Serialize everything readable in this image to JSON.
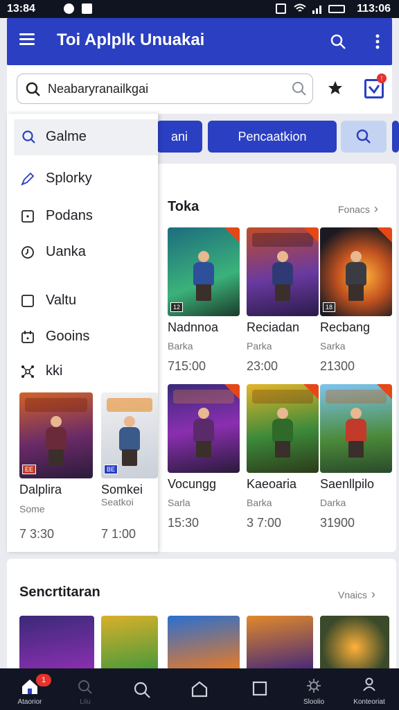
{
  "status_bar": {
    "time": "13:84",
    "right_time": "113:06"
  },
  "app_bar": {
    "title": "Toi Aplplk Unuakai"
  },
  "search": {
    "query": "Neabaryranailkgai"
  },
  "tabs": [
    {
      "label": "ani"
    },
    {
      "label": "Pencaatkion"
    }
  ],
  "drawer": {
    "items": [
      {
        "label": "Galme",
        "icon": "search-icon"
      },
      {
        "label": "Splorky",
        "icon": "pen-icon"
      },
      {
        "label": "Podans",
        "icon": "square-icon"
      },
      {
        "label": "Uanka",
        "icon": "clock-icon"
      },
      {
        "label": "Valtu",
        "icon": "box-icon"
      },
      {
        "label": "Gooins",
        "icon": "calendar-icon"
      },
      {
        "label": "kki",
        "icon": "network-icon"
      }
    ],
    "games": [
      {
        "name": "Dalplira",
        "sub": "Some",
        "price": "7 3:30",
        "tag": "EE"
      },
      {
        "name": "Somkei",
        "sub": "Seatkoi",
        "price": "7 1:00",
        "tag": "BE"
      }
    ]
  },
  "section1": {
    "title": "Toka",
    "more": "Fonacs",
    "games": [
      {
        "name": "Nadnnoa",
        "sub": "Barka",
        "price": "715:00",
        "tag": "12"
      },
      {
        "name": "Reciadan",
        "sub": "Parka",
        "price": "23:00",
        "tag": ""
      },
      {
        "name": "Recbang",
        "sub": "Sarka",
        "price": "21300",
        "tag": "18"
      },
      {
        "name": "Vocungg",
        "sub": "Sarla",
        "price": "15:30",
        "tag": ""
      },
      {
        "name": "Kaeoaria",
        "sub": "Barka",
        "price": "3 7:00",
        "tag": ""
      },
      {
        "name": "Saenllpilo",
        "sub": "Darka",
        "price": "31900",
        "tag": ""
      }
    ]
  },
  "section2": {
    "title": "Sencrtitaran",
    "more": "Vnaics"
  },
  "bottom_nav": [
    {
      "label": "Ataorior",
      "icon": "home-icon",
      "badge": "1"
    },
    {
      "label": "Lilu",
      "icon": "search-icon"
    },
    {
      "label": "",
      "icon": "search-icon"
    },
    {
      "label": "",
      "icon": "home-outline-icon"
    },
    {
      "label": "",
      "icon": "square-icon"
    },
    {
      "label": "Sloolio",
      "icon": "gear-icon"
    },
    {
      "label": "Konteoriat",
      "icon": "person-icon"
    }
  ],
  "colors": {
    "primary": "#2a3fc1",
    "accent": "#e54816",
    "badge": "#e5322d"
  }
}
